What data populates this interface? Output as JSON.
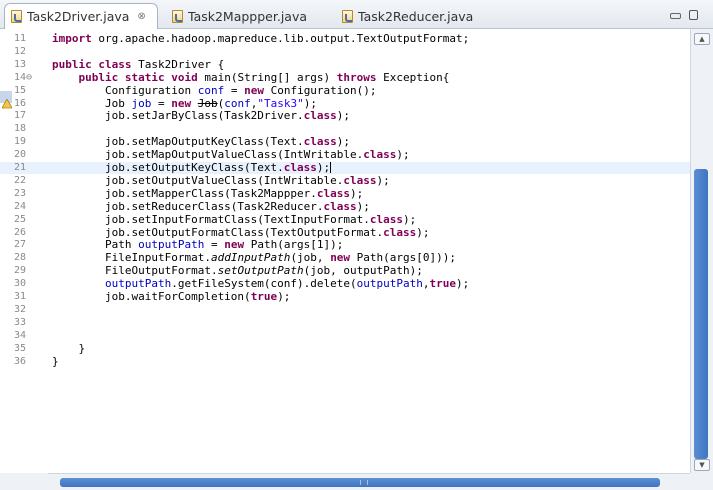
{
  "tabs": [
    {
      "label": "Task2Driver.java",
      "close": "⊗",
      "active": true
    },
    {
      "label": "Task2Mappper.java",
      "active": false
    },
    {
      "label": "Task2Reducer.java",
      "active": false
    }
  ],
  "lines": [
    {
      "n": "11",
      "tokens": [
        {
          "k": "kw",
          "t": "import"
        },
        {
          "t": " org.apache.hadoop.mapreduce.lib.output.TextOutputFormat;"
        }
      ]
    },
    {
      "n": "12",
      "tokens": []
    },
    {
      "n": "13",
      "tokens": [
        {
          "k": "kw",
          "t": "public class"
        },
        {
          "t": " Task2Driver {"
        }
      ]
    },
    {
      "n": "14⊖",
      "tokens": [
        {
          "t": "    "
        },
        {
          "k": "kw",
          "t": "public static void"
        },
        {
          "t": " main(String[] args) "
        },
        {
          "k": "kw",
          "t": "throws"
        },
        {
          "t": " Exception{"
        }
      ]
    },
    {
      "n": "15",
      "tokens": [
        {
          "t": "        Configuration "
        },
        {
          "k": "fld",
          "t": "conf"
        },
        {
          "t": " = "
        },
        {
          "k": "kw",
          "t": "new"
        },
        {
          "t": " Configuration();"
        }
      ]
    },
    {
      "n": "16",
      "warn": true,
      "tokens": [
        {
          "t": "        Job "
        },
        {
          "k": "fld",
          "t": "job"
        },
        {
          "t": " = "
        },
        {
          "k": "kw",
          "t": "new"
        },
        {
          "t": " "
        },
        {
          "k": "strike",
          "t": "Job"
        },
        {
          "t": "("
        },
        {
          "k": "fld",
          "t": "conf"
        },
        {
          "t": ","
        },
        {
          "k": "str",
          "t": "\"Task3\""
        },
        {
          "t": ");"
        }
      ]
    },
    {
      "n": "17",
      "tokens": [
        {
          "t": "        job.setJarByClass(Task2Driver."
        },
        {
          "k": "kw",
          "t": "class"
        },
        {
          "t": ");"
        }
      ]
    },
    {
      "n": "18",
      "tokens": []
    },
    {
      "n": "19",
      "tokens": [
        {
          "t": "        job.setMapOutputKeyClass(Text."
        },
        {
          "k": "kw",
          "t": "class"
        },
        {
          "t": ");"
        }
      ]
    },
    {
      "n": "20",
      "tokens": [
        {
          "t": "        job.setMapOutputValueClass(IntWritable."
        },
        {
          "k": "kw",
          "t": "class"
        },
        {
          "t": ");"
        }
      ]
    },
    {
      "n": "21",
      "current": true,
      "tokens": [
        {
          "t": "        job.setOutputKeyClass(Text."
        },
        {
          "k": "kw",
          "t": "class"
        },
        {
          "t": ");"
        },
        {
          "k": "caret",
          "t": ""
        }
      ]
    },
    {
      "n": "22",
      "tokens": [
        {
          "t": "        job.setOutputValueClass(IntWritable."
        },
        {
          "k": "kw",
          "t": "class"
        },
        {
          "t": ");"
        }
      ]
    },
    {
      "n": "23",
      "tokens": [
        {
          "t": "        job.setMapperClass(Task2Mappper."
        },
        {
          "k": "kw",
          "t": "class"
        },
        {
          "t": ");"
        }
      ]
    },
    {
      "n": "24",
      "tokens": [
        {
          "t": "        job.setReducerClass(Task2Reducer."
        },
        {
          "k": "kw",
          "t": "class"
        },
        {
          "t": ");"
        }
      ]
    },
    {
      "n": "25",
      "tokens": [
        {
          "t": "        job.setInputFormatClass(TextInputFormat."
        },
        {
          "k": "kw",
          "t": "class"
        },
        {
          "t": ");"
        }
      ]
    },
    {
      "n": "26",
      "tokens": [
        {
          "t": "        job.setOutputFormatClass(TextOutputFormat."
        },
        {
          "k": "kw",
          "t": "class"
        },
        {
          "t": ");"
        }
      ]
    },
    {
      "n": "27",
      "tokens": [
        {
          "t": "        Path "
        },
        {
          "k": "fld",
          "t": "outputPath"
        },
        {
          "t": " = "
        },
        {
          "k": "kw",
          "t": "new"
        },
        {
          "t": " Path(args[1]);"
        }
      ]
    },
    {
      "n": "28",
      "tokens": [
        {
          "t": "        FileInputFormat."
        },
        {
          "k": "it",
          "t": "addInputPath"
        },
        {
          "t": "(job, "
        },
        {
          "k": "kw",
          "t": "new"
        },
        {
          "t": " Path(args[0]));"
        }
      ]
    },
    {
      "n": "29",
      "tokens": [
        {
          "t": "        FileOutputFormat."
        },
        {
          "k": "it",
          "t": "setOutputPath"
        },
        {
          "t": "(job, outputPath);"
        }
      ]
    },
    {
      "n": "30",
      "tokens": [
        {
          "t": "        "
        },
        {
          "k": "fld",
          "t": "outputPath"
        },
        {
          "t": ".getFileSystem(conf).delete("
        },
        {
          "k": "fld",
          "t": "outputPath"
        },
        {
          "t": ","
        },
        {
          "k": "kw",
          "t": "true"
        },
        {
          "t": ");"
        }
      ]
    },
    {
      "n": "31",
      "tokens": [
        {
          "t": "        job.waitForCompletion("
        },
        {
          "k": "kw",
          "t": "true"
        },
        {
          "t": ");"
        }
      ]
    },
    {
      "n": "32",
      "tokens": []
    },
    {
      "n": "33",
      "tokens": []
    },
    {
      "n": "34",
      "tokens": []
    },
    {
      "n": "35",
      "tokens": [
        {
          "t": "    }"
        }
      ]
    },
    {
      "n": "36",
      "tokens": [
        {
          "t": "}"
        }
      ]
    }
  ],
  "colors": {
    "keyword": "#7f0055",
    "field": "#0000c0",
    "string": "#2a00ff",
    "current_line": "#e8f2fe",
    "scroll_thumb": "#4a80cb"
  }
}
